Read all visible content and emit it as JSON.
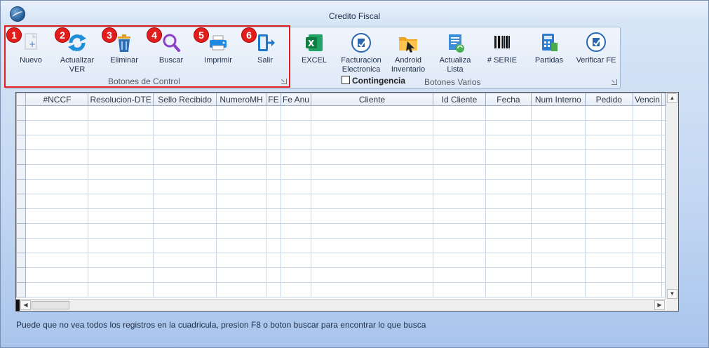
{
  "window": {
    "title": "Credito Fiscal"
  },
  "ribbon": {
    "control_group_label": "Botones de Control",
    "misc_group_label": "Botones Varios",
    "control_buttons": [
      {
        "badge": "1",
        "label": "Nuevo",
        "icon": "new-document-icon"
      },
      {
        "badge": "2",
        "label": "Actualizar VER",
        "icon": "refresh-icon"
      },
      {
        "badge": "3",
        "label": "Eliminar",
        "icon": "trash-icon"
      },
      {
        "badge": "4",
        "label": "Buscar",
        "icon": "search-icon"
      },
      {
        "badge": "5",
        "label": "Imprimir",
        "icon": "printer-icon"
      },
      {
        "badge": "6",
        "label": "Salir",
        "icon": "exit-icon"
      }
    ],
    "misc_buttons": [
      {
        "label": "EXCEL",
        "icon": "excel-icon"
      },
      {
        "label": "Facturacion Electronica",
        "icon": "e-invoice-seal-icon"
      },
      {
        "label": "Android Inventario",
        "icon": "folder-android-icon"
      },
      {
        "label": "Actualiza Lista",
        "icon": "list-refresh-icon"
      },
      {
        "label": "# SERIE",
        "icon": "barcode-icon"
      },
      {
        "label": "Partidas",
        "icon": "calculator-icon"
      },
      {
        "label": "Verificar FE",
        "icon": "verify-seal-icon"
      }
    ],
    "contingencia": {
      "label": "Contingencia",
      "checked": false
    }
  },
  "grid": {
    "columns": [
      "#NCCF",
      "Resolucion-DTE",
      "Sello Recibido",
      "NumeroMH",
      "FE",
      "Fe Anu",
      "Cliente",
      "Id Cliente",
      "Fecha",
      "Num Interno",
      "Pedido",
      "Vencin"
    ],
    "rows": []
  },
  "status": {
    "text": "Puede que no vea todos los registros en la cuadricula, presion F8 o boton buscar para encontrar lo que busca"
  },
  "colors": {
    "badge": "#e01e1e",
    "highlight_border": "#e02020",
    "window_bg": "#c4d8f3"
  }
}
